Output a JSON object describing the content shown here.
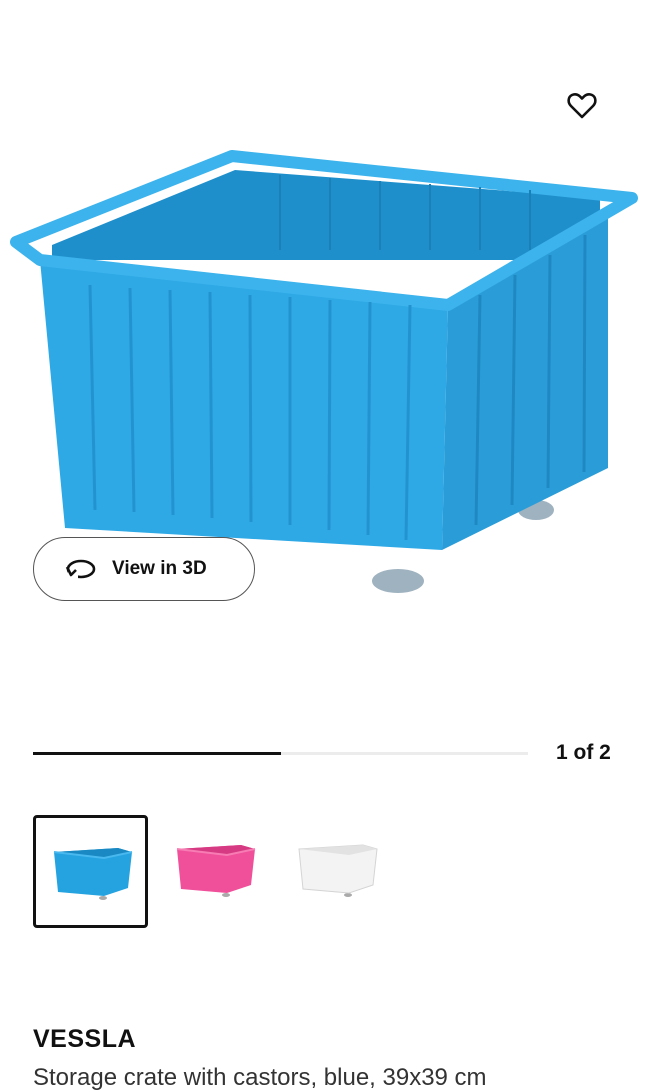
{
  "favorite": {
    "icon": "heart-outline-icon"
  },
  "view3d": {
    "icon": "rotate-3d-icon",
    "label": "View in 3D"
  },
  "gallery": {
    "counter": "1 of 2",
    "progress": 0.5,
    "thumbnails": [
      {
        "color": "#25a3e0",
        "selected": true
      },
      {
        "color": "#f0509a",
        "selected": false
      },
      {
        "color": "#f3f3f3",
        "selected": false
      }
    ]
  },
  "product": {
    "name": "VESSLA",
    "description": "Storage crate with castors, blue, 39x39 cm"
  },
  "colors": {
    "primary_product": "#2aa6e2",
    "text": "#111111"
  }
}
